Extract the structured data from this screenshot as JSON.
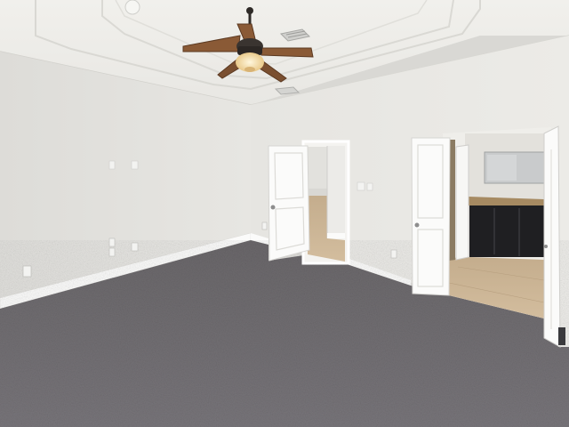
{
  "scene": {
    "subject": "empty bedroom",
    "colors": {
      "wall_left": "#e4e3df",
      "wall_right": "#e9e8e4",
      "ceiling": "#efeeea",
      "carpet": "#6d6a6c",
      "trim": "#ffffff",
      "door": "#fbfbfa",
      "tile": "#c9b393",
      "vanity": "#1f1f22",
      "countertop": "#a68a62",
      "fan_blade": "#8a5a36",
      "fan_light": "#f3d9a0"
    },
    "icons": [
      "ceiling-fan-icon",
      "light-switch-icon",
      "outlet-icon",
      "ceiling-vent-icon"
    ]
  }
}
